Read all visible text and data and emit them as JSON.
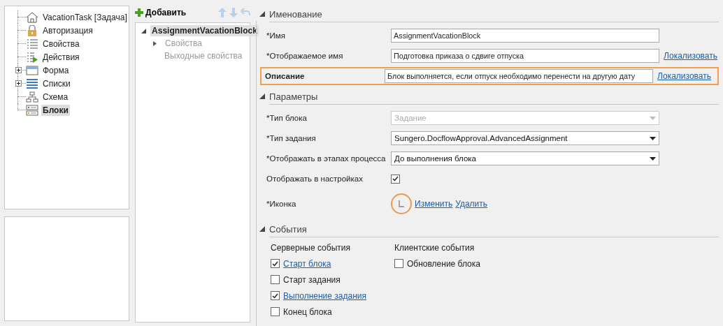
{
  "tree": {
    "items": [
      {
        "label": "VacationTask [Задача]",
        "kind": "house",
        "selected": false
      },
      {
        "label": "Авторизация",
        "kind": "lock",
        "selected": false
      },
      {
        "label": "Свойства",
        "kind": "list",
        "selected": false
      },
      {
        "label": "Действия",
        "kind": "actions",
        "selected": false
      },
      {
        "label": "Форма",
        "kind": "form",
        "selected": false,
        "expanded": false
      },
      {
        "label": "Списки",
        "kind": "lists",
        "selected": false,
        "expanded": false
      },
      {
        "label": "Схема",
        "kind": "scheme",
        "selected": false
      },
      {
        "label": "Блоки",
        "kind": "blocks",
        "selected": true
      }
    ]
  },
  "blocks_toolbar": {
    "add_label": "Добавить"
  },
  "blocks": {
    "items": [
      {
        "label": "AssignmentVacationBlock",
        "selected": true,
        "expanded": true,
        "children": [
          {
            "label": "Свойства",
            "kind": "group",
            "disabled": true
          },
          {
            "label": "Выходные свойства",
            "kind": "leaf",
            "disabled": true
          }
        ]
      }
    ]
  },
  "sections": [
    {
      "title": "Именование",
      "expanded": true,
      "rows": [
        {
          "kind": "text",
          "label": "*Имя",
          "value": "AssignmentVacationBlock"
        },
        {
          "kind": "text",
          "label": "*Отображаемое имя",
          "value": "Подготовка приказа о сдвиге отпуска",
          "link": "Локализовать"
        },
        {
          "kind": "text",
          "label": "Описание",
          "value": "Блок выполняется, если отпуск необходимо перенести на другую дату",
          "link": "Локализовать",
          "highlighted": true
        }
      ]
    },
    {
      "title": "Параметры",
      "expanded": true,
      "rows": [
        {
          "kind": "combo",
          "label": "*Тип блока",
          "value": "Задание",
          "disabled": true
        },
        {
          "kind": "combo",
          "label": "*Тип задания",
          "value": "Sungero.DocflowApproval.AdvancedAssignment",
          "disabled": false
        },
        {
          "kind": "combo",
          "label": "*Отображать в этапах процесса",
          "value": "До выполнения блока",
          "disabled": false
        },
        {
          "kind": "check",
          "label": "Отображать в настройках",
          "checked": true
        },
        {
          "kind": "icon",
          "label": "*Иконка",
          "change": "Изменить",
          "delete": "Удалить"
        }
      ]
    },
    {
      "title": "События",
      "expanded": true,
      "columns": [
        {
          "title": "Серверные события",
          "events": [
            {
              "label": "Старт блока",
              "checked": true
            },
            {
              "label": "Старт задания",
              "checked": false
            },
            {
              "label": "Выполнение задания",
              "checked": true
            },
            {
              "label": "Конец блока",
              "checked": false
            }
          ]
        },
        {
          "title": "Клиентские события",
          "events": [
            {
              "label": "Обновление блока",
              "checked": false
            }
          ]
        }
      ]
    }
  ]
}
